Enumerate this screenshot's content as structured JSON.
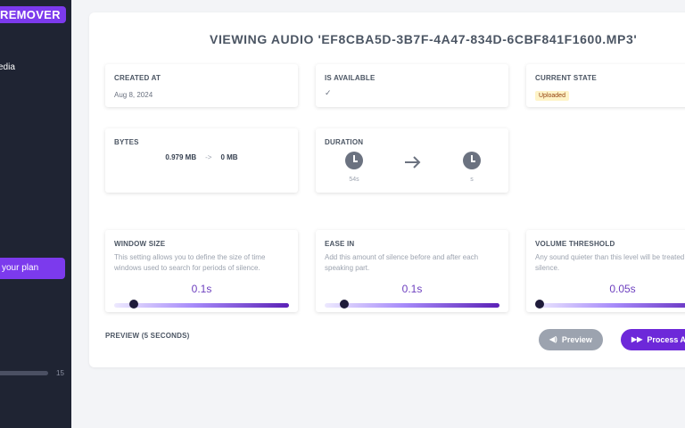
{
  "sidebar": {
    "brand": "REMOVER",
    "nav_item": "edia",
    "plan_button": "your plan",
    "usage_tick": "",
    "usage_max": "15",
    "usage_fraction": 0
  },
  "page": {
    "title": "VIEWING AUDIO 'EF8CBA5D-3B7F-4A47-834D-6CBF841F1600.MP3'"
  },
  "info": {
    "created_label": "CREATED AT",
    "created_value": "Aug 8, 2024",
    "available_label": "IS AVAILABLE",
    "available_value": "✓",
    "state_label": "CURRENT STATE",
    "state_value": "Uploaded",
    "state_color": "#fef3c7"
  },
  "bytes": {
    "label": "BYTES",
    "from": "0.979 MB",
    "arrow": "->",
    "to": "0 MB"
  },
  "duration": {
    "label": "DURATION",
    "from": "54s",
    "to": "s",
    "from_icon": "clock-icon",
    "to_icon": "clock-icon",
    "arrow_icon": "arrow-right-icon"
  },
  "settings": [
    {
      "label": "WINDOW SIZE",
      "description": "This setting allows you to define the size of time windows used to search for periods of silence.",
      "value": "0.1s",
      "level": 0.1
    },
    {
      "label": "EASE IN",
      "description": "Add this amount of silence before and after each speaking part.",
      "value": "0.1s",
      "level": 0.1
    },
    {
      "label": "VOLUME THRESHOLD",
      "description": "Any sound quieter than this level will be treated as silence.",
      "value": "0.05s",
      "level": 0.05
    }
  ],
  "preview": {
    "label": "PREVIEW (5 SECONDS)",
    "preview_button": "Preview",
    "process_button": "Process Audio",
    "preview_icon": "volume-icon",
    "process_icon": "fast-forward-icon"
  },
  "colors": {
    "accent": "#7c3aed",
    "sidebar": "#1f2433",
    "preview_button": "#9ca3af"
  }
}
